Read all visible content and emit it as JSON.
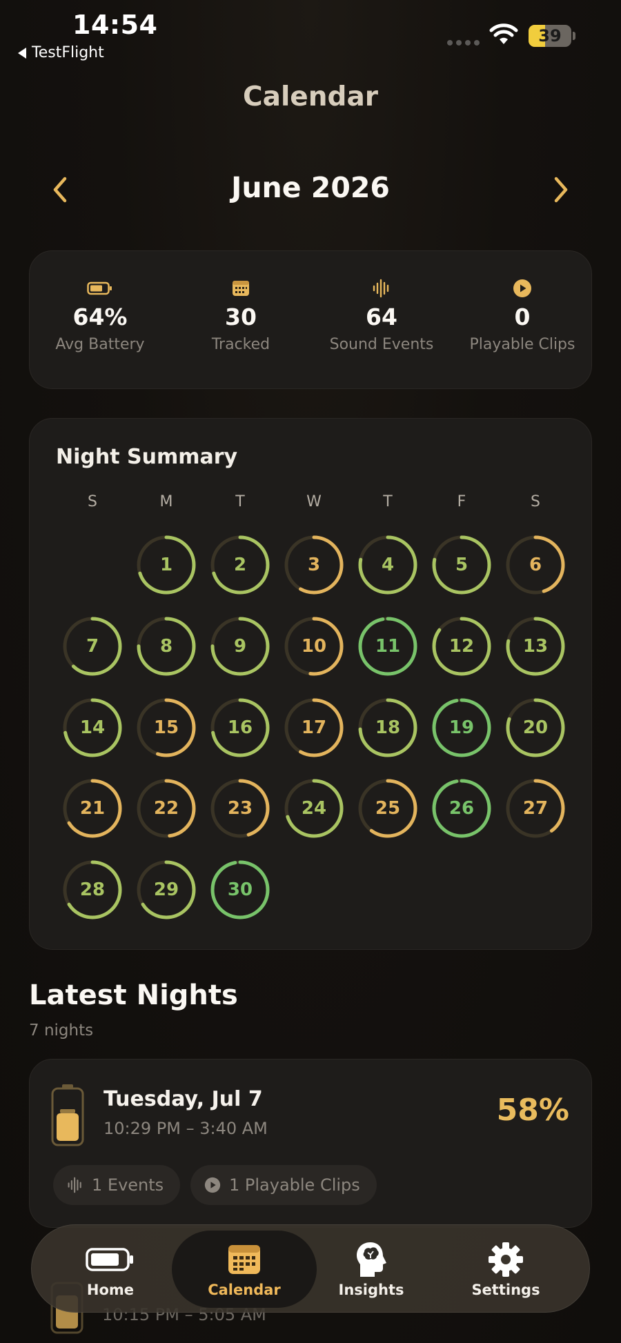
{
  "status_bar": {
    "time": "14:54",
    "back_label": "TestFlight",
    "battery_level": "39"
  },
  "header": {
    "title": "Calendar"
  },
  "month_nav": {
    "month": "June 2026"
  },
  "stats": [
    {
      "value": "64%",
      "label": "Avg Battery",
      "icon": "battery-icon"
    },
    {
      "value": "30",
      "label": "Tracked",
      "icon": "calendar-icon"
    },
    {
      "value": "64",
      "label": "Sound Events",
      "icon": "waveform-icon"
    },
    {
      "value": "0",
      "label": "Playable Clips",
      "icon": "play-icon"
    }
  ],
  "night_summary": {
    "title": "Night Summary",
    "weekdays": [
      "S",
      "M",
      "T",
      "W",
      "T",
      "F",
      "S"
    ],
    "start_weekday": 1,
    "colors": {
      "green": "#78c36a",
      "lime": "#a9c462",
      "amber": "#e3b45d",
      "track": "#3a3426"
    },
    "days": [
      {
        "day": "1",
        "ring": 0.7,
        "tone": "lime"
      },
      {
        "day": "2",
        "ring": 0.7,
        "tone": "lime"
      },
      {
        "day": "3",
        "ring": 0.58,
        "tone": "amber"
      },
      {
        "day": "4",
        "ring": 0.78,
        "tone": "lime"
      },
      {
        "day": "5",
        "ring": 0.78,
        "tone": "lime"
      },
      {
        "day": "6",
        "ring": 0.45,
        "tone": "amber"
      },
      {
        "day": "7",
        "ring": 0.62,
        "tone": "lime"
      },
      {
        "day": "8",
        "ring": 0.75,
        "tone": "lime"
      },
      {
        "day": "9",
        "ring": 0.75,
        "tone": "lime"
      },
      {
        "day": "10",
        "ring": 0.52,
        "tone": "amber"
      },
      {
        "day": "11",
        "ring": 0.97,
        "tone": "green"
      },
      {
        "day": "12",
        "ring": 0.85,
        "tone": "lime"
      },
      {
        "day": "13",
        "ring": 0.78,
        "tone": "lime"
      },
      {
        "day": "14",
        "ring": 0.72,
        "tone": "lime"
      },
      {
        "day": "15",
        "ring": 0.55,
        "tone": "amber"
      },
      {
        "day": "16",
        "ring": 0.72,
        "tone": "lime"
      },
      {
        "day": "17",
        "ring": 0.58,
        "tone": "amber"
      },
      {
        "day": "18",
        "ring": 0.74,
        "tone": "lime"
      },
      {
        "day": "19",
        "ring": 0.97,
        "tone": "green"
      },
      {
        "day": "20",
        "ring": 0.8,
        "tone": "lime"
      },
      {
        "day": "21",
        "ring": 0.66,
        "tone": "amber"
      },
      {
        "day": "22",
        "ring": 0.48,
        "tone": "amber"
      },
      {
        "day": "23",
        "ring": 0.45,
        "tone": "amber"
      },
      {
        "day": "24",
        "ring": 0.7,
        "tone": "lime"
      },
      {
        "day": "25",
        "ring": 0.6,
        "tone": "amber"
      },
      {
        "day": "26",
        "ring": 0.97,
        "tone": "green"
      },
      {
        "day": "27",
        "ring": 0.4,
        "tone": "amber"
      },
      {
        "day": "28",
        "ring": 0.66,
        "tone": "lime"
      },
      {
        "day": "29",
        "ring": 0.66,
        "tone": "lime"
      },
      {
        "day": "30",
        "ring": 0.97,
        "tone": "green"
      }
    ]
  },
  "latest": {
    "title": "Latest Nights",
    "subtitle": "7 nights",
    "items": [
      {
        "date": "Tuesday, Jul 7",
        "time_range": "10:29 PM – 3:40 AM",
        "battery": "58%",
        "events_chip": "1 Events",
        "clips_chip": "1 Playable Clips"
      },
      {
        "time_range": "10:15 PM – 5:05 AM"
      }
    ]
  },
  "tab_bar": {
    "tabs": [
      {
        "label": "Home",
        "icon": "battery-icon"
      },
      {
        "label": "Calendar",
        "icon": "calendar-icon",
        "active": true
      },
      {
        "label": "Insights",
        "icon": "brain-head-icon"
      },
      {
        "label": "Settings",
        "icon": "gear-icon"
      }
    ]
  }
}
